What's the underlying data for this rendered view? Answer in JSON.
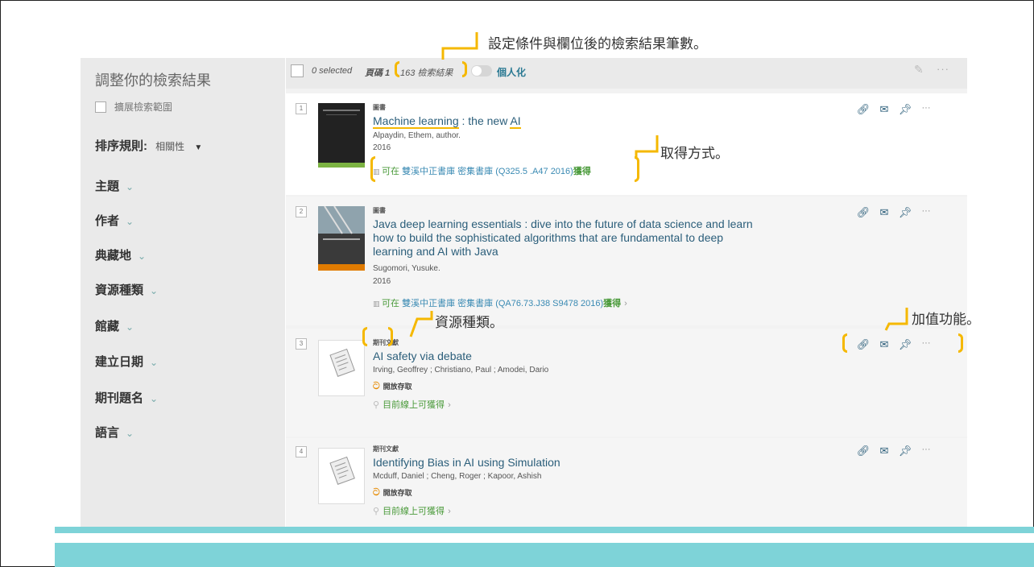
{
  "sidebar": {
    "title": "調整你的檢索結果",
    "expand_label": "擴展檢索範圍",
    "sort_label": "排序規則:",
    "sort_value": "相關性",
    "facets": [
      "主題",
      "作者",
      "典藏地",
      "資源種類",
      "館藏",
      "建立日期",
      "期刊題名",
      "語言"
    ]
  },
  "topbar": {
    "selected": "0 selected",
    "page": "頁碼 1",
    "count": "163 檢索結果",
    "personalize": "個人化"
  },
  "results": [
    {
      "num": "1",
      "type": "圖書",
      "title_parts": [
        "Machine learning",
        " : the new ",
        "AI"
      ],
      "author": "Alpaydin, Ethem, author.",
      "year": "2016",
      "avail_prefix": "可在",
      "avail_lib": "雙溪中正書庫  密集書庫",
      "avail_call": "(Q325.5 .A47 2016)",
      "avail_got": "獲得"
    },
    {
      "num": "2",
      "type": "圖書",
      "title_line1": "Java deep learning essentials : dive into the future of data science and learn",
      "title_line2": "how to build the sophisticated algorithms that are fundamental to deep",
      "title_line3": "learning and AI with Java",
      "author": "Sugomori, Yusuke.",
      "year": "2016",
      "avail_prefix": "可在",
      "avail_lib": "雙溪中正書庫  密集書庫",
      "avail_call": "(QA76.73.J38 S9478 2016)",
      "avail_got": "獲得"
    },
    {
      "num": "3",
      "type": "期刊文獻",
      "title": "AI safety via debate",
      "author": "Irving, Geoffrey ; Christiano, Paul ; Amodei, Dario",
      "open_access": "開放存取",
      "online": "目前線上可獲得"
    },
    {
      "num": "4",
      "type": "期刊文獻",
      "title": "Identifying Bias in AI using Simulation",
      "author": "Mcduff, Daniel ; Cheng, Roger ; Kapoor, Ashish",
      "open_access": "開放存取",
      "online": "目前線上可獲得"
    }
  ],
  "annotations": {
    "result_count": "設定條件與欄位後的檢索結果筆數。",
    "access_method": "取得方式。",
    "resource_type": "資源種類。",
    "value_added": "加值功能。"
  },
  "colors": {
    "highlight": "#f5b800",
    "teal": "#7ed3d8",
    "link": "#2b5e7a",
    "available": "#4a9a3a"
  }
}
